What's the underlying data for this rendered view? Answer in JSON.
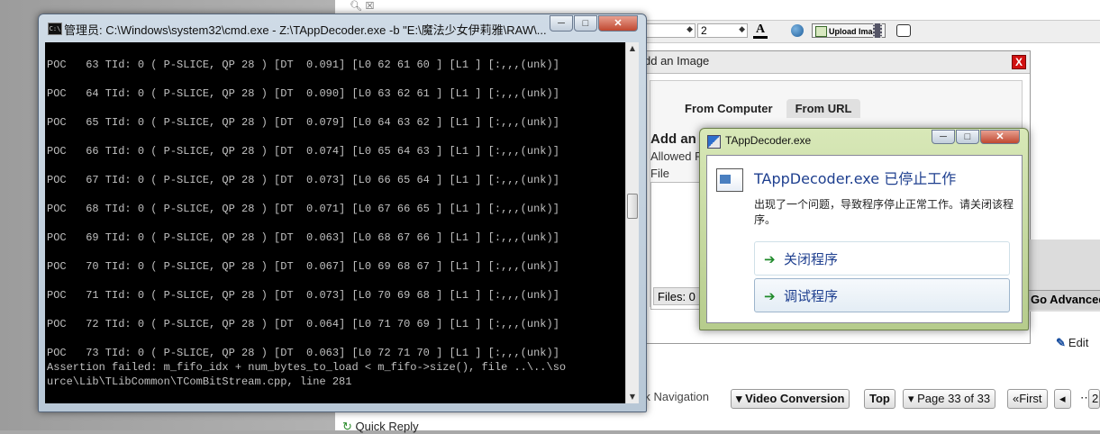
{
  "forum": {
    "toolbar": {
      "size_value": "2",
      "color_label": "A",
      "upload_label": "Upload Image"
    },
    "add_image_dialog": {
      "title": "dd an Image",
      "close": "X",
      "tabs": [
        "From Computer",
        "From URL"
      ],
      "heading": "Add an",
      "allowed": "Allowed F",
      "file_label": "File",
      "files_count": "Files: 0"
    },
    "go_advanced": "Go Advanced",
    "edit": "Edit",
    "quick_navigation": "ick Navigation",
    "nav_dropdown": "Video Conversion",
    "top": "Top",
    "page_info": "Page 33 of 33",
    "first": "First",
    "prev": "◂",
    "page_num": "2",
    "quick_reply": "Quick Reply"
  },
  "cmd": {
    "title": "管理员: C:\\Windows\\system32\\cmd.exe - Z:\\TAppDecoder.exe  -b \"E:\\魔法少女伊莉雅\\RAW\\...",
    "minimize": "─",
    "maximize": "□",
    "close": "✕",
    "lines": [
      "POC   63 TId: 0 ( P-SLICE, QP 28 ) [DT  0.091] [L0 62 61 60 ] [L1 ] [:,,,(unk)]",
      "POC   64 TId: 0 ( P-SLICE, QP 28 ) [DT  0.090] [L0 63 62 61 ] [L1 ] [:,,,(unk)]",
      "POC   65 TId: 0 ( P-SLICE, QP 28 ) [DT  0.079] [L0 64 63 62 ] [L1 ] [:,,,(unk)]",
      "POC   66 TId: 0 ( P-SLICE, QP 28 ) [DT  0.074] [L0 65 64 63 ] [L1 ] [:,,,(unk)]",
      "POC   67 TId: 0 ( P-SLICE, QP 28 ) [DT  0.073] [L0 66 65 64 ] [L1 ] [:,,,(unk)]",
      "POC   68 TId: 0 ( P-SLICE, QP 28 ) [DT  0.071] [L0 67 66 65 ] [L1 ] [:,,,(unk)]",
      "POC   69 TId: 0 ( P-SLICE, QP 28 ) [DT  0.063] [L0 68 67 66 ] [L1 ] [:,,,(unk)]",
      "POC   70 TId: 0 ( P-SLICE, QP 28 ) [DT  0.067] [L0 69 68 67 ] [L1 ] [:,,,(unk)]",
      "POC   71 TId: 0 ( P-SLICE, QP 28 ) [DT  0.073] [L0 70 69 68 ] [L1 ] [:,,,(unk)]",
      "POC   72 TId: 0 ( P-SLICE, QP 28 ) [DT  0.064] [L0 71 70 69 ] [L1 ] [:,,,(unk)]",
      "POC   73 TId: 0 ( P-SLICE, QP 28 ) [DT  0.063] [L0 72 71 70 ] [L1 ] [:,,,(unk)]"
    ],
    "assert_line1": "Assertion failed: m_fifo_idx + num_bytes_to_load < m_fifo->size(), file ..\\..\\so",
    "assert_line2": "urce\\Lib\\TLibCommon\\TComBitStream.cpp, line 281"
  },
  "error_dialog": {
    "title": "TAppDecoder.exe",
    "heading": "TAppDecoder.exe 已停止工作",
    "message": "出现了一个问题，导致程序停止正常工作。请关闭该程序。",
    "option_close": "关闭程序",
    "option_debug": "调试程序"
  }
}
